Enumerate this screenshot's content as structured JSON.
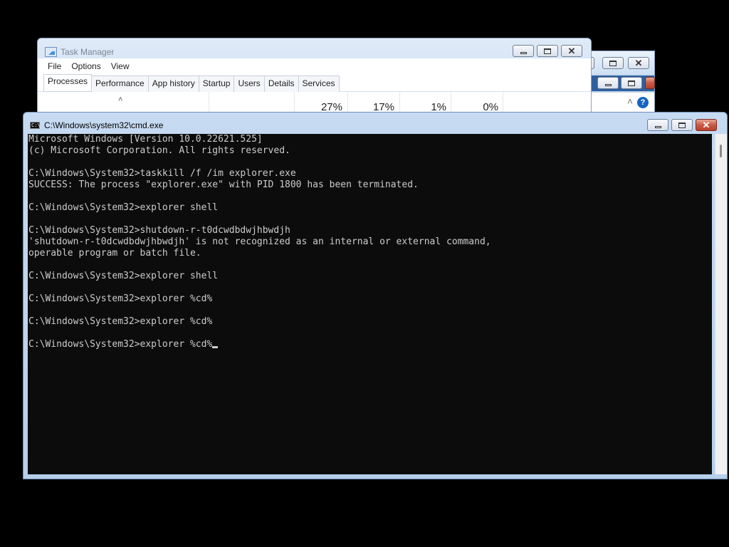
{
  "taskmanager": {
    "title": "Task Manager",
    "menu": [
      "File",
      "Options",
      "View"
    ],
    "tabs": [
      "Processes",
      "Performance",
      "App history",
      "Startup",
      "Users",
      "Details",
      "Services"
    ],
    "active_tab": "Processes",
    "columns": {
      "cpu": "27%",
      "memory": "17%",
      "disk": "1%",
      "network": "0%"
    }
  },
  "bgwindow": {
    "help_glyph": "?"
  },
  "cmd": {
    "title": "C:\\Windows\\system32\\cmd.exe",
    "icon_text": "C:\\",
    "lines": [
      "Microsoft Windows [Version 10.0.22621.525]",
      "(c) Microsoft Corporation. All rights reserved.",
      "",
      "C:\\Windows\\System32>taskkill /f /im explorer.exe",
      "SUCCESS: The process \"explorer.exe\" with PID 1800 has been terminated.",
      "",
      "C:\\Windows\\System32>explorer shell",
      "",
      "C:\\Windows\\System32>shutdown-r-t0dcwdbdwjhbwdjh",
      "'shutdown-r-t0dcwdbdwjhbwdjh' is not recognized as an internal or external command,",
      "operable program or batch file.",
      "",
      "C:\\Windows\\System32>explorer shell",
      "",
      "C:\\Windows\\System32>explorer %cd%",
      "",
      "C:\\Windows\\System32>explorer %cd%",
      "",
      "C:\\Windows\\System32>explorer %cd%"
    ]
  },
  "colors": {
    "console_bg": "#0c0c0c",
    "console_fg": "#cccccc",
    "chrome": "#c6dbf2",
    "close_red": "#c85a45",
    "help_blue": "#1565c0"
  }
}
